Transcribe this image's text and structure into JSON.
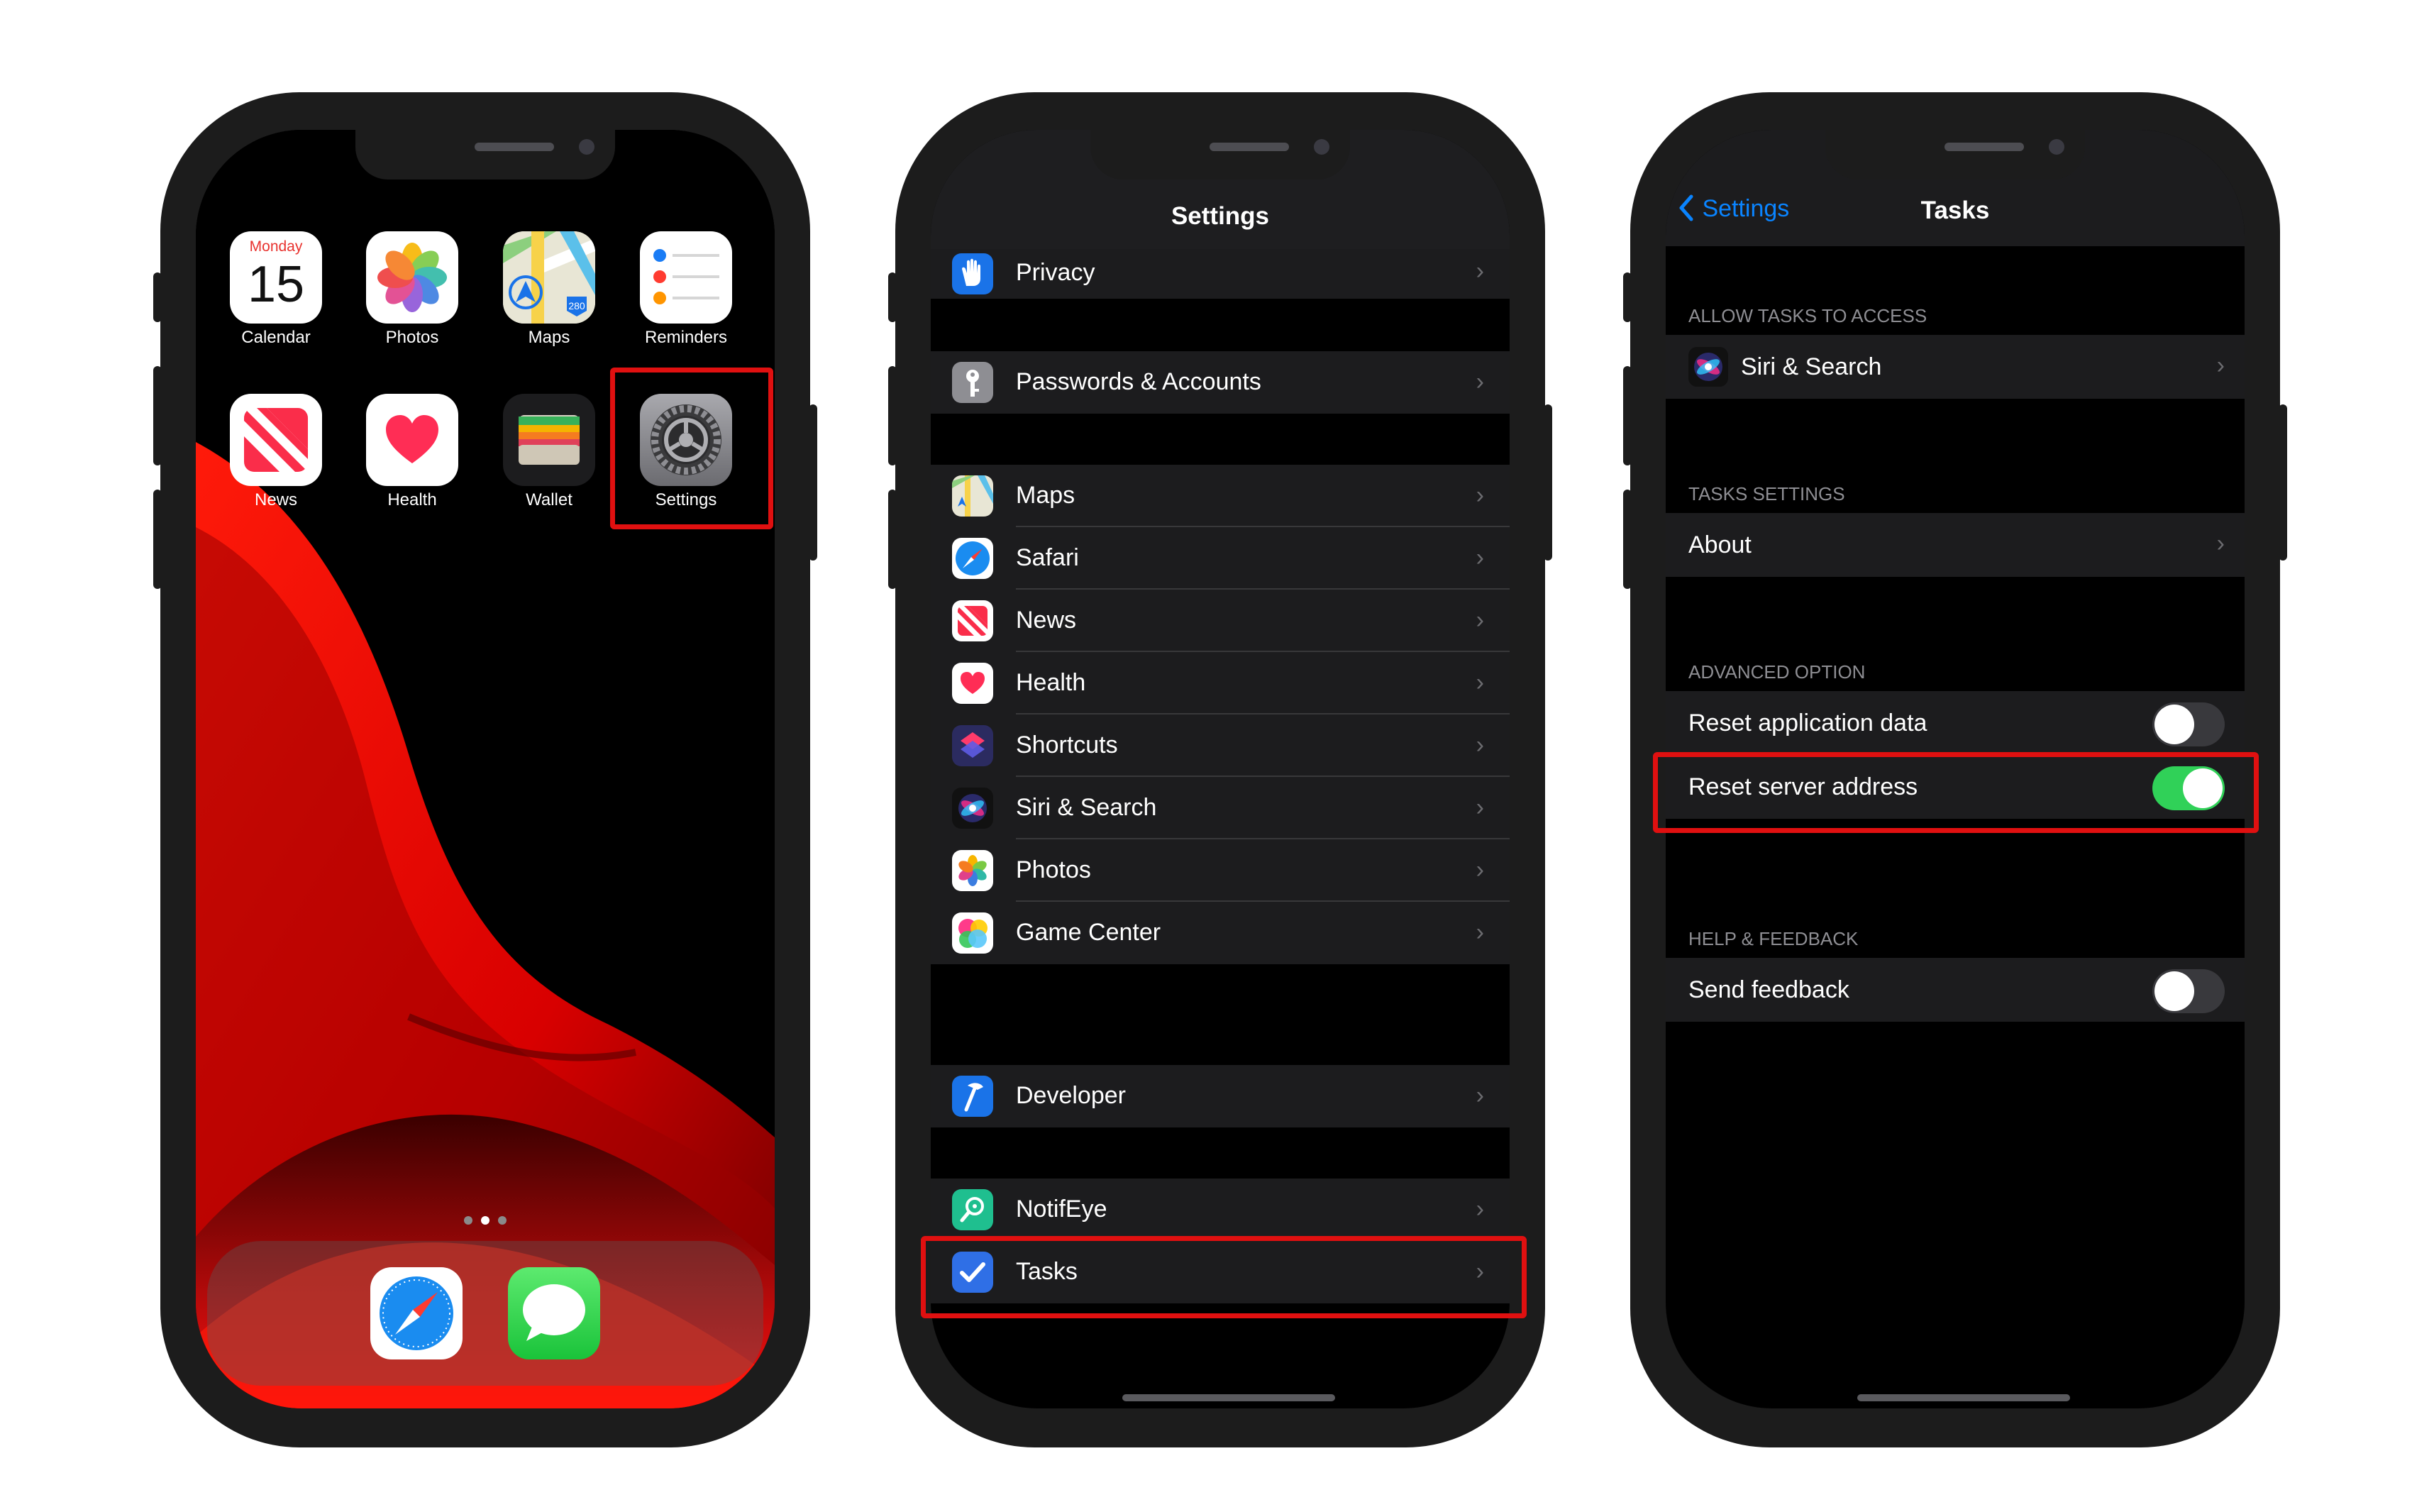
{
  "home": {
    "calendar": {
      "weekday": "Monday",
      "day": "15",
      "label": "Calendar"
    },
    "apps_row1": [
      "Photos",
      "Maps",
      "Reminders"
    ],
    "apps_row2": [
      "News",
      "Health",
      "Wallet",
      "Settings"
    ],
    "maps_shield": "280",
    "dock_apps": [
      "safari-icon",
      "messages-icon"
    ],
    "page_dots": 3,
    "current_page": 2
  },
  "settings": {
    "title": "Settings",
    "rows": [
      {
        "label": "Privacy",
        "icon": "privacy-hand-icon"
      },
      {
        "label": "Passwords & Accounts",
        "icon": "key-icon"
      },
      {
        "label": "Maps",
        "icon": "maps-icon"
      },
      {
        "label": "Safari",
        "icon": "safari-icon"
      },
      {
        "label": "News",
        "icon": "news-icon"
      },
      {
        "label": "Health",
        "icon": "health-heart-icon"
      },
      {
        "label": "Shortcuts",
        "icon": "shortcuts-icon"
      },
      {
        "label": "Siri & Search",
        "icon": "siri-icon"
      },
      {
        "label": "Photos",
        "icon": "photos-icon"
      },
      {
        "label": "Game Center",
        "icon": "game-center-icon"
      },
      {
        "label": "Developer",
        "icon": "developer-hammer-icon"
      },
      {
        "label": "NotifEye",
        "icon": "notifeye-icon"
      },
      {
        "label": "Tasks",
        "icon": "tasks-check-icon"
      }
    ]
  },
  "tasks": {
    "back_label": "Settings",
    "title": "Tasks",
    "sections": {
      "access_header": "ALLOW TASKS TO ACCESS",
      "access_row": "Siri & Search",
      "settings_header": "TASKS SETTINGS",
      "settings_row": "About",
      "advanced_header": "ADVANCED OPTION",
      "reset_app_data": "Reset application data",
      "reset_app_data_on": false,
      "reset_server": "Reset server address",
      "reset_server_on": true,
      "help_header": "HELP & FEEDBACK",
      "send_feedback": "Send feedback",
      "send_feedback_on": false
    }
  },
  "colors": {
    "highlight": "#e01010",
    "toggle_on": "#30d158",
    "link_blue": "#0a84ff",
    "cell_bg": "#1c1c1e"
  }
}
